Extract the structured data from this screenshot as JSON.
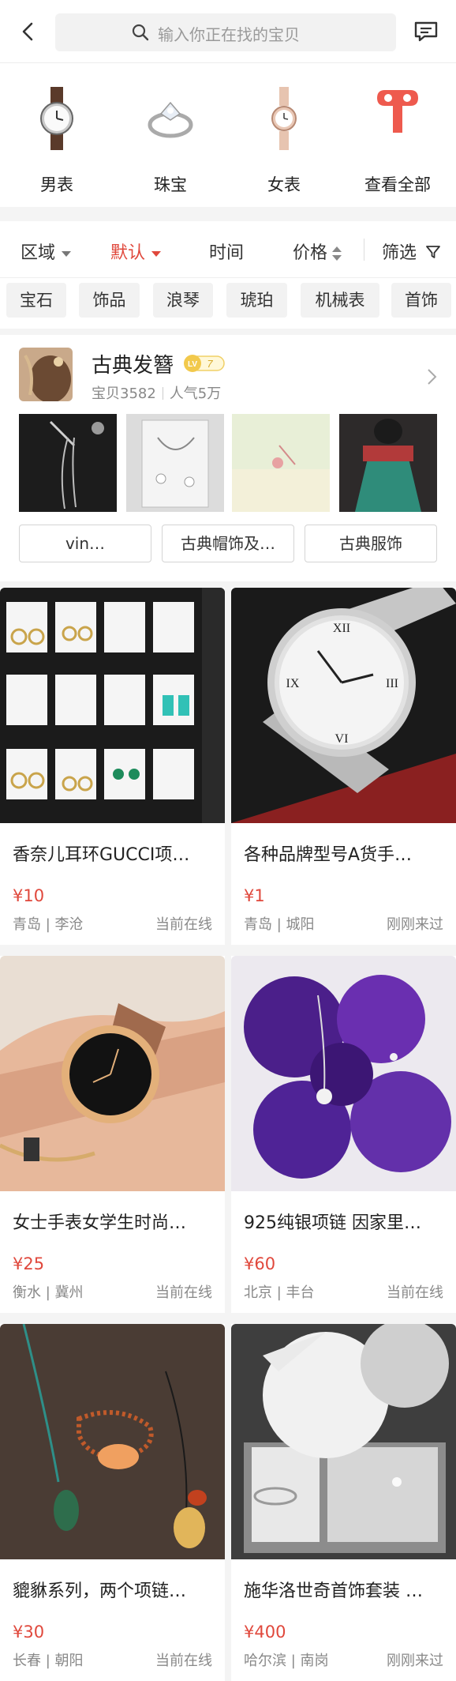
{
  "search": {
    "placeholder": "输入你正在找的宝贝"
  },
  "categories": [
    {
      "label": "男表",
      "icon": "mens-watch-icon"
    },
    {
      "label": "珠宝",
      "icon": "ring-icon"
    },
    {
      "label": "女表",
      "icon": "womens-watch-icon"
    },
    {
      "label": "查看全部",
      "icon": "key-icon"
    }
  ],
  "filters": {
    "region": "区域",
    "default": "默认",
    "time": "时间",
    "price": "价格",
    "filter": "筛选"
  },
  "tags": [
    "宝石",
    "饰品",
    "浪琴",
    "琥珀",
    "机械表",
    "首饰"
  ],
  "shop": {
    "name": "古典发簪",
    "level": "7",
    "items": "宝贝3582",
    "popularity": "人气5万",
    "buttons": [
      "vin…",
      "古典帽饰及…",
      "古典服饰"
    ]
  },
  "products": [
    {
      "title": "香奈儿耳环GUCCI项…",
      "price": "¥10",
      "location": "青岛 | 李沧",
      "status": "当前在线"
    },
    {
      "title": "各种品牌型号A货手…",
      "price": "¥1",
      "location": "青岛 | 城阳",
      "status": "刚刚来过"
    },
    {
      "title": "女士手表女学生时尚…",
      "price": "¥25",
      "location": "衡水 | 冀州",
      "status": "当前在线"
    },
    {
      "title": "925纯银项链 因家里…",
      "price": "¥60",
      "location": "北京 | 丰台",
      "status": "当前在线"
    },
    {
      "title": "貔貅系列，两个项链…",
      "price": "¥30",
      "location": "长春 | 朝阳",
      "status": "当前在线"
    },
    {
      "title": "施华洛世奇首饰套装 …",
      "price": "¥400",
      "location": "哈尔滨 | 南岗",
      "status": "刚刚来过"
    }
  ],
  "colors": {
    "accent": "#e0483c",
    "text": "#222222",
    "muted": "#888888",
    "background": "#f4f4f4"
  }
}
